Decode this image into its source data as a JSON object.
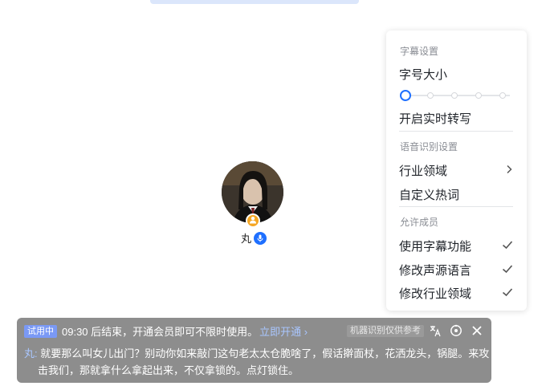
{
  "participant": {
    "name": "丸"
  },
  "settings_panel": {
    "subtitle_section": "字幕设置",
    "font_size_label": "字号大小",
    "font_size_level": 0,
    "font_size_steps": 6,
    "realtime_transcribe_label": "开启实时转写",
    "asr_section": "语音识别设置",
    "industry_label": "行业领域",
    "hotwords_label": "自定义热词",
    "members_section": "允许成员",
    "permissions": [
      {
        "label": "使用字幕功能",
        "checked": true
      },
      {
        "label": "修改声源语言",
        "checked": true
      },
      {
        "label": "修改行业领域",
        "checked": true
      }
    ]
  },
  "caption_bar": {
    "trial_badge": "试用中",
    "trial_message": "09:30 后结束，开通会员即可不限时使用。",
    "open_link": "立即开通",
    "disclaimer": "机器识别仅供参考",
    "speaker": "丸:",
    "text": "就要那么叫女儿出门？别动你如来敲门这句老太太仓脆啥了，假话擀面杖，花洒龙头，锅腿。来攻击我们，那就拿什么拿起出来，不仅拿锁的。点灯锁住。"
  },
  "colors": {
    "accent": "#1e6fff",
    "host_badge": "#f5a623",
    "caption_bg": "#8d8d8d",
    "link": "#a9c6ff"
  }
}
